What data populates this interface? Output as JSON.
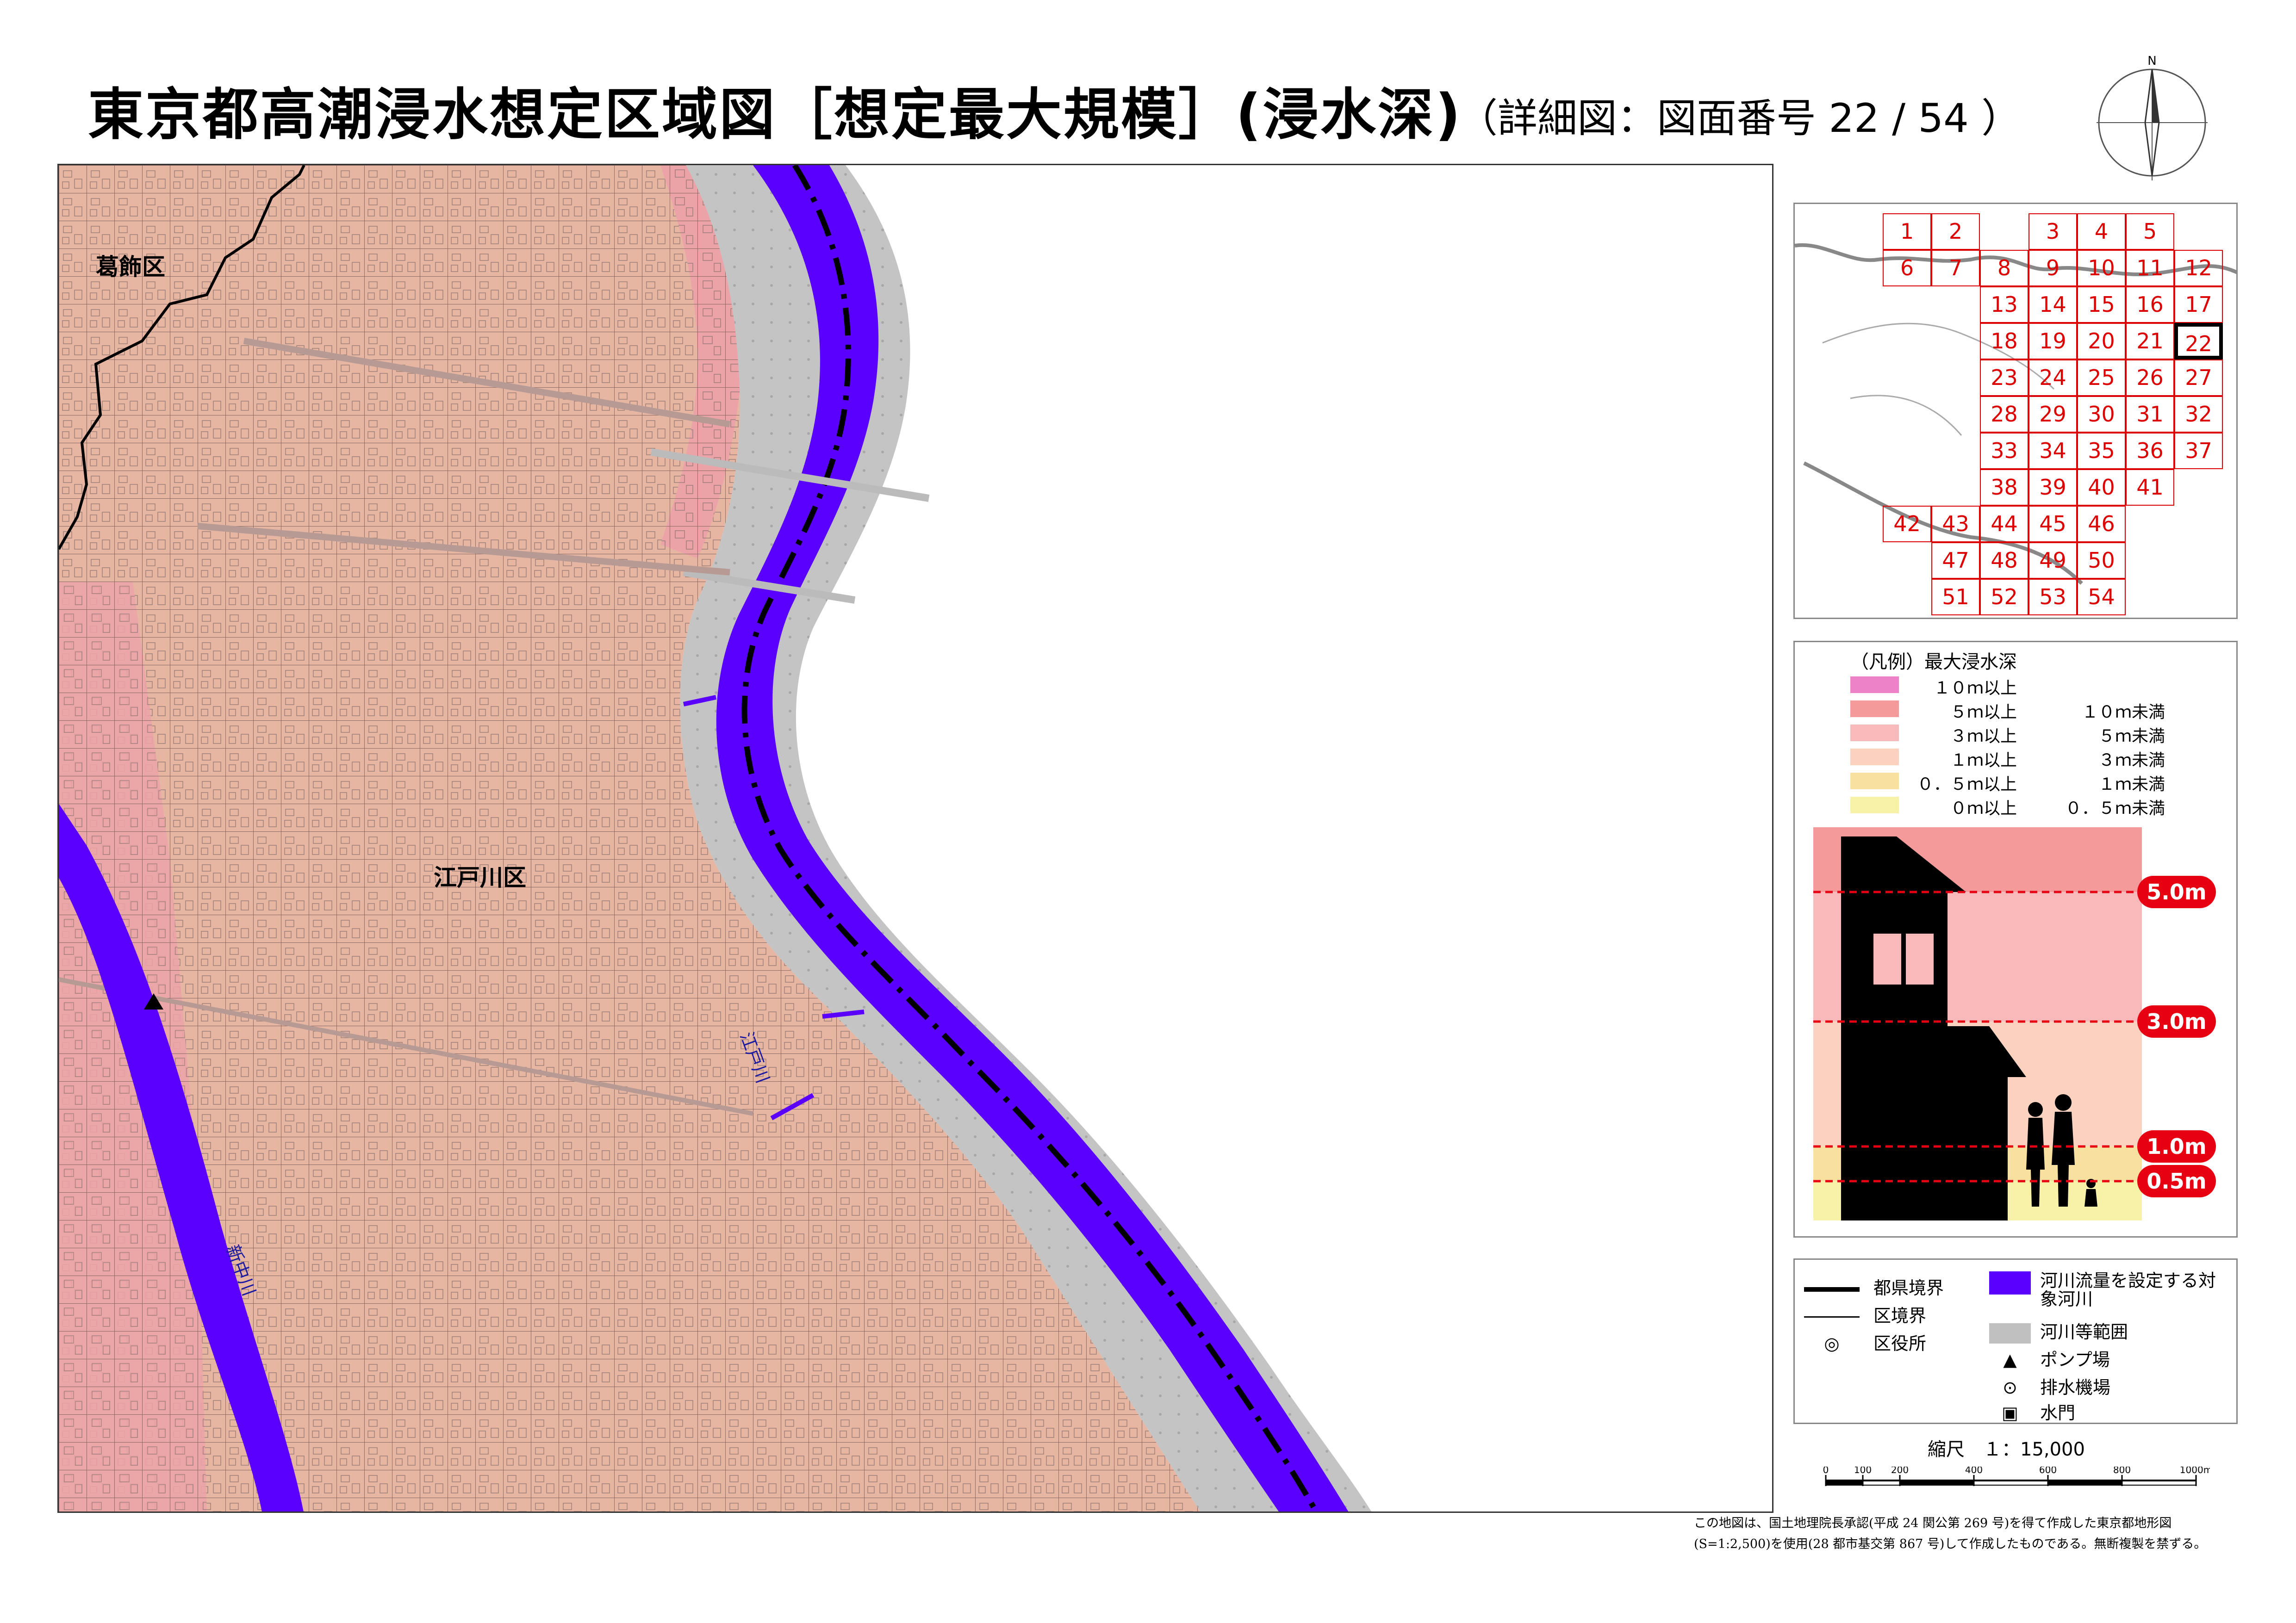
{
  "header": {
    "title": "東京都高潮浸水想定区域図［想定最大規模］(浸水深)",
    "subtitle": "（詳細図：図面番号 22 / 54 ）"
  },
  "compass": {
    "north_label": "N"
  },
  "map": {
    "ward_labels": [
      "葛飾区",
      "江戸川区"
    ],
    "river_labels": [
      "江戸川",
      "新中川"
    ],
    "colors": {
      "flood_0_05": "#f5f0a0",
      "flood_05_1": "#f5deb0",
      "flood_1_3": "#e8b49e",
      "flood_3_5": "#eba3a3",
      "target_river": "#5a00ff",
      "river_area": "#c0c0c0"
    }
  },
  "index_map": {
    "cells": [
      "1",
      "2",
      "3",
      "4",
      "5",
      "6",
      "7",
      "8",
      "9",
      "10",
      "11",
      "12",
      "13",
      "14",
      "15",
      "16",
      "17",
      "18",
      "19",
      "20",
      "21",
      "22",
      "23",
      "24",
      "25",
      "26",
      "27",
      "28",
      "29",
      "30",
      "31",
      "32",
      "33",
      "34",
      "35",
      "36",
      "37",
      "38",
      "39",
      "40",
      "41",
      "42",
      "43",
      "44",
      "45",
      "46",
      "47",
      "48",
      "49",
      "50",
      "51",
      "52",
      "53",
      "54"
    ],
    "current": "22"
  },
  "legend": {
    "title": "（凡例）最大浸水深",
    "rows": [
      {
        "from": "１０ｍ以上",
        "to": "",
        "color": "#ee82c8"
      },
      {
        "from": "５ｍ以上",
        "to": "１０ｍ未満",
        "color": "#f59a9a"
      },
      {
        "from": "３ｍ以上",
        "to": "５ｍ未満",
        "color": "#f7b9b9"
      },
      {
        "from": "１ｍ以上",
        "to": "３ｍ未満",
        "color": "#fbd2c0"
      },
      {
        "from": "０．５ｍ以上",
        "to": "１ｍ未満",
        "color": "#f7e0a0"
      },
      {
        "from": "０ｍ以上",
        "to": "０．５ｍ未満",
        "color": "#f7f2a8"
      }
    ],
    "levels": [
      "5.0m",
      "3.0m",
      "1.0m",
      "0.5m"
    ]
  },
  "symbols": {
    "prefecture_boundary": "都県境界",
    "ward_boundary": "区境界",
    "ward_office": "区役所",
    "target_river": "河川流量を設定する対象河川",
    "river_area": "河川等範囲",
    "pump_station": "ポンプ場",
    "drainage_station": "排水機場",
    "sluice_gate": "水門"
  },
  "scale": {
    "label": "縮尺　１：15,000",
    "ticks": [
      "0",
      "100",
      "200",
      "400",
      "600",
      "800",
      "1000m"
    ]
  },
  "copyright": "この地図は、国土地理院長承認(平成 24 関公第 269 号)を得て作成した東京都地形図(S=1:2,500)を使用(28 都市基交第 867 号)して作成したものである。無断複製を禁ずる。"
}
